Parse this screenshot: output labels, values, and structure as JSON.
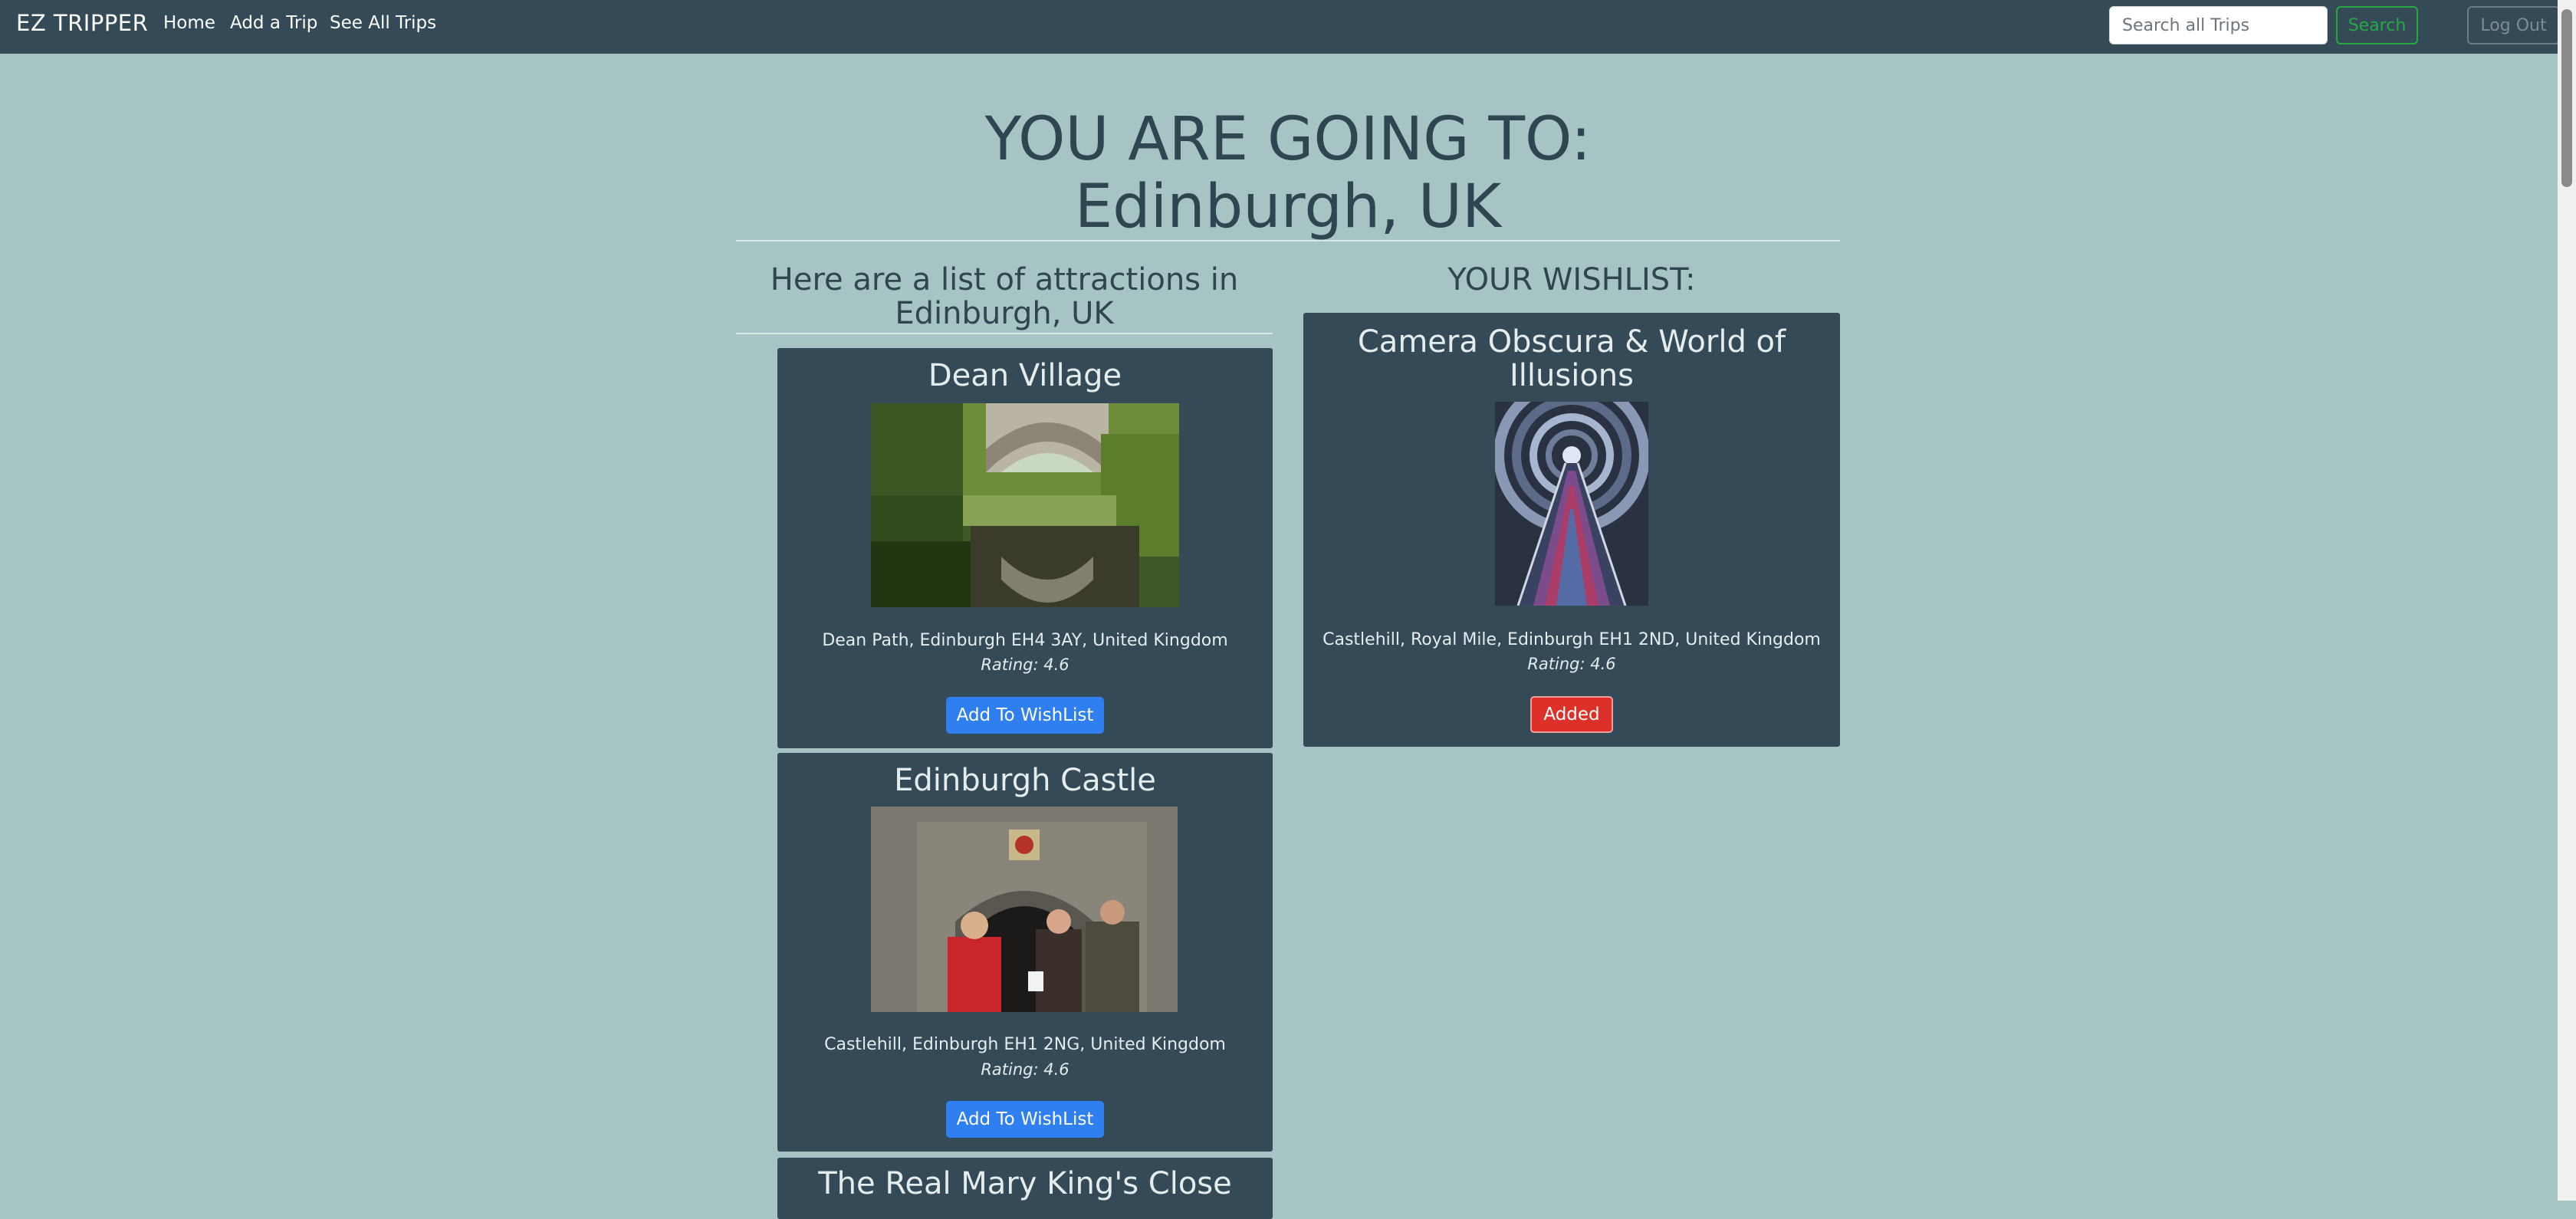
{
  "navbar": {
    "brand": "EZ TRIPPER",
    "links": [
      "Home",
      "Add a Trip",
      "See All Trips"
    ],
    "search_placeholder": "Search all Trips",
    "search_label": "Search",
    "logout_label": "Log Out"
  },
  "hero": {
    "line1": "YOU ARE GOING TO:",
    "destination": "Edinburgh, UK"
  },
  "attractions": {
    "heading": "Here are a list of attractions in Edinburgh, UK",
    "add_label": "Add To WishList",
    "items": [
      {
        "name": "Dean Village",
        "address": "Dean Path, Edinburgh EH4 3AY, United Kingdom",
        "rating": "Rating: 4.6",
        "image_icon": "bridge-river-photo"
      },
      {
        "name": "Edinburgh Castle",
        "address": "Castlehill, Edinburgh EH1 2NG, United Kingdom",
        "rating": "Rating: 4.6",
        "image_icon": "castle-gate-photo"
      },
      {
        "name": "The Real Mary King's Close"
      }
    ]
  },
  "wishlist": {
    "heading": "YOUR WISHLIST:",
    "items": [
      {
        "name": "Camera Obscura & World of Illusions",
        "address": "Castlehill, Royal Mile, Edinburgh EH1 2ND, United Kingdom",
        "rating": "Rating: 4.6",
        "status_label": "Added",
        "image_icon": "illusion-tunnel-photo"
      }
    ]
  },
  "colors": {
    "background": "#a7c4c4",
    "navbar": "#344a56",
    "card": "#344a56",
    "primary_button": "#2f7ff0",
    "added_button": "#dc3028",
    "search_outline": "#28a745"
  }
}
